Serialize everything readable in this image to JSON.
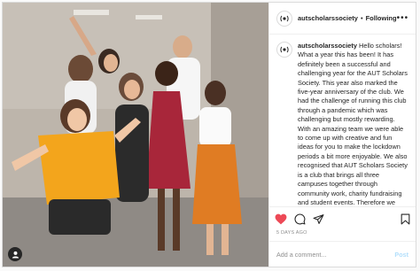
{
  "header": {
    "username": "autscholarssociety",
    "separator": "•",
    "follow_label": "Following",
    "more_label": "•••"
  },
  "caption": {
    "username": "autscholarssociety",
    "text": "Hello scholars! What a year this has been! It has definitely been a successful and challenging year for the AUT Scholars Society. This year also marked the five-year anniversary of the club. We had the challenge of running this club through a pandemic which was challenging but mostly rewarding. With an amazing team we were able to come up with creative and fun ideas for you to make the lockdown periods a bit more enjoyable. We also recognised that AUT Scholars Society is a club that brings all three campuses together through community work, charity fundraising and student events. Therefore we wanted to push our 'once a scholar"
  },
  "actions": {
    "like_icon": "heart-icon",
    "comment_icon": "comment-icon",
    "share_icon": "share-icon",
    "save_icon": "bookmark-icon",
    "like_color": "#ed4956"
  },
  "meta": {
    "date": "5 DAYS AGO"
  },
  "comment": {
    "placeholder": "Add a comment...",
    "post_label": "Post"
  },
  "colors": {
    "accent": "#0095f6",
    "post_disabled": "#b2dffc"
  }
}
